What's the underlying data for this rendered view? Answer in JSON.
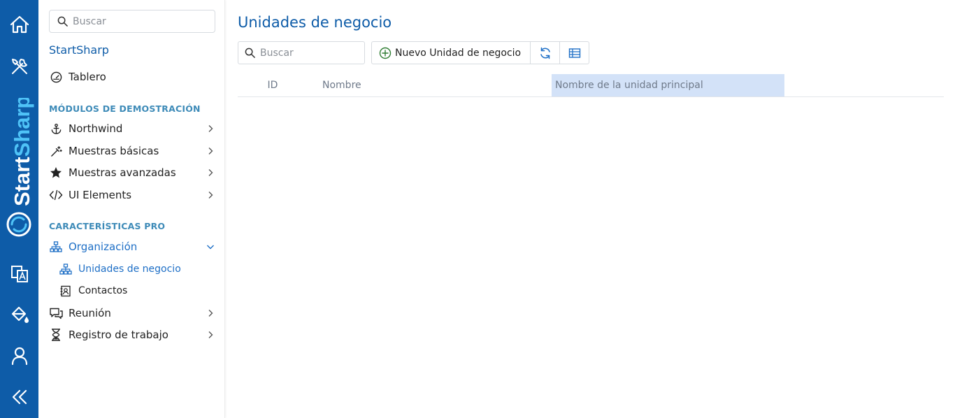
{
  "rail": {
    "brand": "StartSharp",
    "colors": {
      "bg": "#0e5ca8",
      "brand_start": "#ffffff",
      "brand_sharp": "#4fc3f7"
    },
    "icons": [
      "home-icon",
      "tools-icon",
      "translate-icon",
      "paint-bucket-icon",
      "user-icon",
      "collapse-icon"
    ]
  },
  "sidebar": {
    "search_placeholder": "Buscar",
    "title": "StartSharp",
    "dashboard": "Tablero",
    "section_demo": "MÓDULOS DE DEMOSTRACIÓN",
    "demo_items": [
      {
        "label": "Northwind",
        "icon": "anchor-icon"
      },
      {
        "label": "Muestras básicas",
        "icon": "wand-icon"
      },
      {
        "label": "Muestras avanzadas",
        "icon": "star-icon"
      },
      {
        "label": "UI Elements",
        "icon": "code-icon"
      }
    ],
    "section_pro": "CARACTERÍSTICAS PRO",
    "organization": "Organización",
    "org_children": [
      {
        "label": "Unidades de negocio",
        "icon": "sitemap-icon"
      },
      {
        "label": "Contactos",
        "icon": "contact-card-icon"
      }
    ],
    "more_items": [
      {
        "label": "Reunión",
        "icon": "chat-icon"
      },
      {
        "label": "Registro de trabajo",
        "icon": "hourglass-icon"
      }
    ]
  },
  "main": {
    "title": "Unidades de negocio",
    "search_placeholder": "Buscar",
    "add_button": "Nuevo Unidad de negocio",
    "columns": [
      "ID",
      "Nombre",
      "Nombre de la unidad principal"
    ],
    "colors": {
      "accent": "#0e5ca8",
      "active_link": "#1e6fc6",
      "header_selected": "#d3e2f8"
    }
  }
}
